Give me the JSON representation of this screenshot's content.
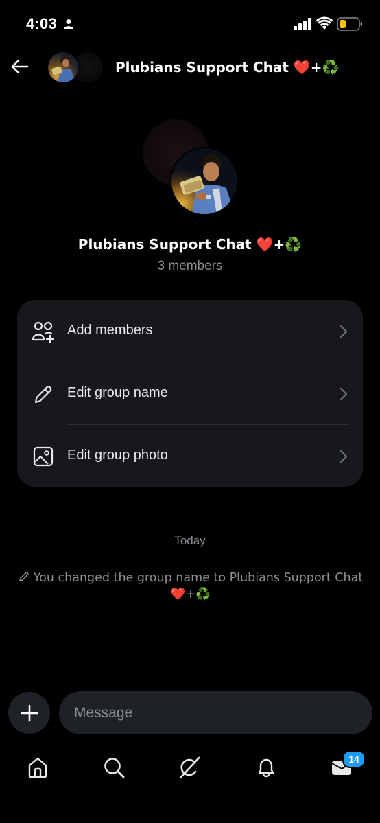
{
  "status_bar": {
    "time": "4:03",
    "icons": [
      "person-icon",
      "signal-icon",
      "wifi-icon",
      "battery-icon"
    ],
    "battery_color": "#f7c600"
  },
  "header": {
    "back_icon": "back-arrow-icon",
    "title": "Plubians Support Chat ❤️+♻️"
  },
  "group": {
    "name": "Plubians Support Chat ❤️+♻️",
    "members": "3 members"
  },
  "options": [
    {
      "icon": "add-members-icon",
      "label": "Add members"
    },
    {
      "icon": "pencil-icon",
      "label": "Edit group name"
    },
    {
      "icon": "image-icon",
      "label": "Edit group photo"
    }
  ],
  "conversation": {
    "day_label": "Today",
    "system_message": "You changed the group name to Plubians Support Chat ❤️+♻️"
  },
  "composer": {
    "plus_icon": "plus-icon",
    "placeholder": "Message"
  },
  "bottom_nav": {
    "items": [
      "home-icon",
      "search-icon",
      "grok-icon",
      "notifications-icon",
      "messages-icon"
    ],
    "messages_badge": "14"
  },
  "colors": {
    "background": "#000000",
    "card": "#16181c",
    "muted_text": "#8b8f94",
    "accent": "#1d9bf0"
  }
}
